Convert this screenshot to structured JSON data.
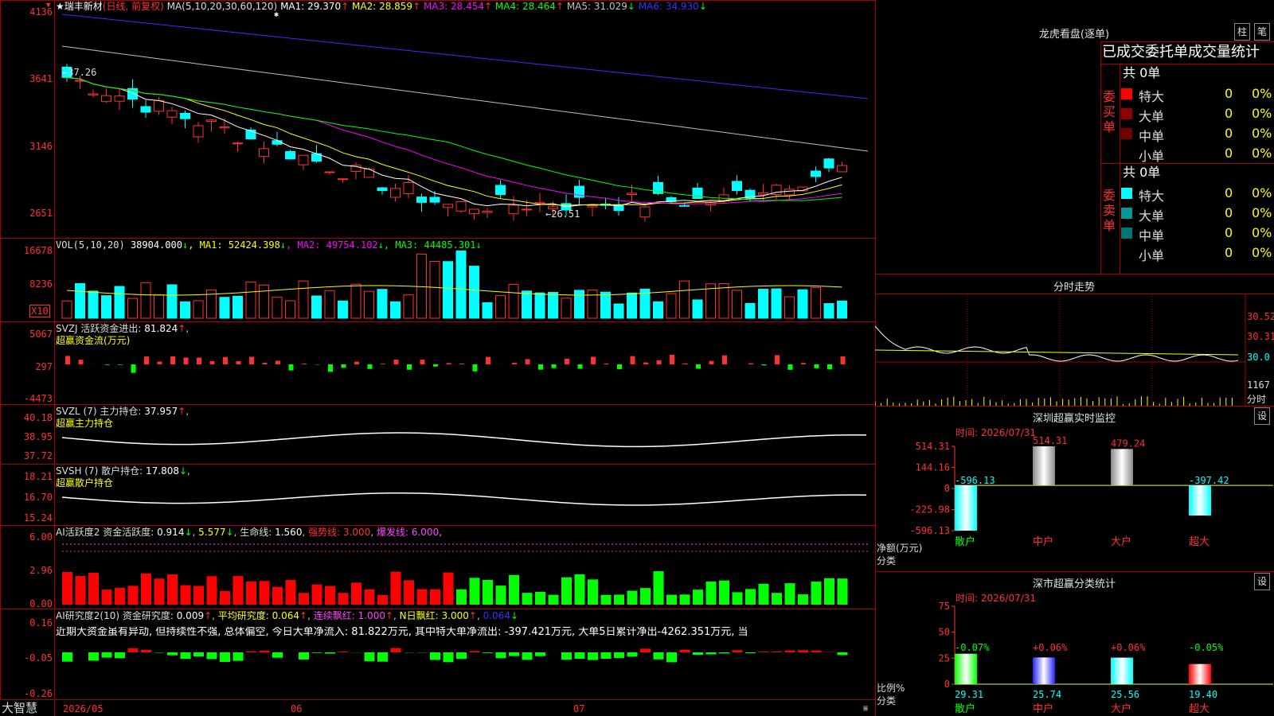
{
  "stock": {
    "name": "瑞丰新材",
    "mode": "(日线, 前复权)",
    "ma_label": "MA(5,10,20,30,60,120)",
    "ma": [
      {
        "label": "MA1:",
        "value": "29.370",
        "arrow": "↑",
        "color": "#ffffff"
      },
      {
        "label": "MA2:",
        "value": "28.859",
        "arrow": "↑",
        "color": "#ffff00"
      },
      {
        "label": "MA3:",
        "value": "28.454",
        "arrow": "↑",
        "color": "#ff00ff"
      },
      {
        "label": "MA4:",
        "value": "28.464",
        "arrow": "↑",
        "color": "#00ff00"
      },
      {
        "label": "MA5:",
        "value": "31.029",
        "arrow": "↓",
        "color": "#c0c0c0"
      },
      {
        "label": "MA6:",
        "value": "34.930",
        "arrow": "↓",
        "color": "#3333ff"
      }
    ],
    "price_axis": [
      "4136",
      "3641",
      "3146",
      "2651"
    ],
    "price_high_note": "←37.26",
    "price_low_note": "←26.51"
  },
  "volume": {
    "title": "VOL(5,10,20)",
    "value": "38904.000",
    "arrow": "↓",
    "ma": [
      {
        "label": "MA1:",
        "value": "52424.398",
        "arrow": "↓",
        "color": "#ffff00"
      },
      {
        "label": "MA2:",
        "value": "49754.102",
        "arrow": "↓",
        "color": "#ff00ff"
      },
      {
        "label": "MA3:",
        "value": "44485.301",
        "arrow": "↓",
        "color": "#00ff00"
      }
    ],
    "axis": [
      "16678",
      "8236"
    ],
    "unit": "X10"
  },
  "svzj": {
    "title": "SVZJ",
    "label": "活跃资金进出:",
    "value": "81.824",
    "arrow": "↑",
    "subtitle": "超赢资金流(万元)",
    "axis": [
      "5067",
      "297",
      "-4473"
    ]
  },
  "svzl": {
    "title": "SVZL (7)",
    "label": "主力持仓:",
    "value": "37.957",
    "arrow": "↑",
    "subtitle": "超赢主力持仓",
    "axis": [
      "40.18",
      "38.95",
      "37.72"
    ]
  },
  "svsh": {
    "title": "SVSH (7)",
    "label": "散户持仓:",
    "value": "17.808",
    "arrow": "↓",
    "subtitle": "超赢散户持仓",
    "axis": [
      "18.21",
      "16.70",
      "15.24"
    ]
  },
  "ai_active": {
    "title": "AI活跃度2",
    "l1": "资金活跃度:",
    "v1": "0.914",
    "a1": "↓",
    "v2": "5.577",
    "a2": "↓",
    "l3": "生命线:",
    "v3": "1.560",
    "l4": "强势线:",
    "v4": "3.000",
    "l5": "爆发线:",
    "v5": "6.000",
    "axis": [
      "6.00",
      "2.96",
      "0.00"
    ]
  },
  "ai_research": {
    "title": "AI研究度2(10)",
    "l1": "资金研究度:",
    "v1": "0.009",
    "a1": "↑",
    "l2": "平均研究度:",
    "v2": "0.064",
    "a2": "↑",
    "l3": "连续飘红:",
    "v3": "1.000",
    "a3": "↑",
    "l4": "N日飘红:",
    "v4": "3.000",
    "a4": "↑",
    "v5": "0.064",
    "a5": "↓",
    "comment": "近期大资金虽有异动, 但持续性不强, 总体偏空, 今日大单净流入: 81.822万元, 其中特大单净流出: -397.421万元, 大单5日累计净出-4262.351万元, 当",
    "axis": [
      "0.16",
      "-0.05",
      "-0.26"
    ]
  },
  "date_axis": {
    "brand": "大智慧",
    "labels": [
      "2026/05",
      "06",
      "07"
    ]
  },
  "dragon_tiger": {
    "title": "龙虎看盘(逐单)",
    "btn1": "柱",
    "btn2": "笔",
    "header": "已成交委托单成交量统计",
    "buy_label": "委买单",
    "sell_label": "委卖单",
    "buy_total": "共 0单",
    "sell_total": "共 0单",
    "buy_rows": [
      {
        "name": "特大",
        "count": "0",
        "pct": "0%",
        "color": "#ff0000"
      },
      {
        "name": "大单",
        "count": "0",
        "pct": "0%",
        "color": "#900000"
      },
      {
        "name": "中单",
        "count": "0",
        "pct": "0%",
        "color": "#700000"
      },
      {
        "name": "小单",
        "count": "0",
        "pct": "0%",
        "color": "#000000"
      }
    ],
    "sell_rows": [
      {
        "name": "特大",
        "count": "0",
        "pct": "0%",
        "color": "#00ffff"
      },
      {
        "name": "大单",
        "count": "0",
        "pct": "0%",
        "color": "#009999"
      },
      {
        "name": "中单",
        "count": "0",
        "pct": "0%",
        "color": "#007777"
      },
      {
        "name": "小单",
        "count": "0",
        "pct": "0%",
        "color": "#000000"
      }
    ]
  },
  "intraday": {
    "title": "分时走势",
    "axis": [
      "30.52",
      "30.31",
      "30.0"
    ],
    "vol_label": "1167",
    "tab_label": "分时"
  },
  "sz_monitor": {
    "title": "深圳超赢实时监控",
    "btn": "设",
    "time": "时间: 2026/07/31",
    "axis": [
      "514.31",
      "144.16",
      "0",
      "-225.98",
      "-596.13"
    ],
    "y_label": "净额(万元)",
    "x_label": "分类",
    "cats": [
      "散户",
      "中户",
      "大户",
      "超大"
    ],
    "values": [
      -596.13,
      514.31,
      479.24,
      -397.42
    ],
    "value_labels": [
      "-596.13",
      "514.31",
      "479.24",
      "-397.42"
    ]
  },
  "sz_class": {
    "title": "深市超赢分类统计",
    "btn": "设",
    "time": "时间: 2026/07/31",
    "axis": [
      "75",
      "50",
      "25",
      "0"
    ],
    "y_label": "比例%",
    "x_label": "分类",
    "cats": [
      "散户",
      "中户",
      "大户",
      "超大"
    ],
    "values": [
      29.31,
      25.74,
      25.56,
      19.4
    ],
    "value_labels": [
      "29.31",
      "25.74",
      "25.56",
      "19.40"
    ],
    "changes": [
      "-0.07%",
      "+0.06%",
      "+0.06%",
      "-0.05%"
    ]
  }
}
